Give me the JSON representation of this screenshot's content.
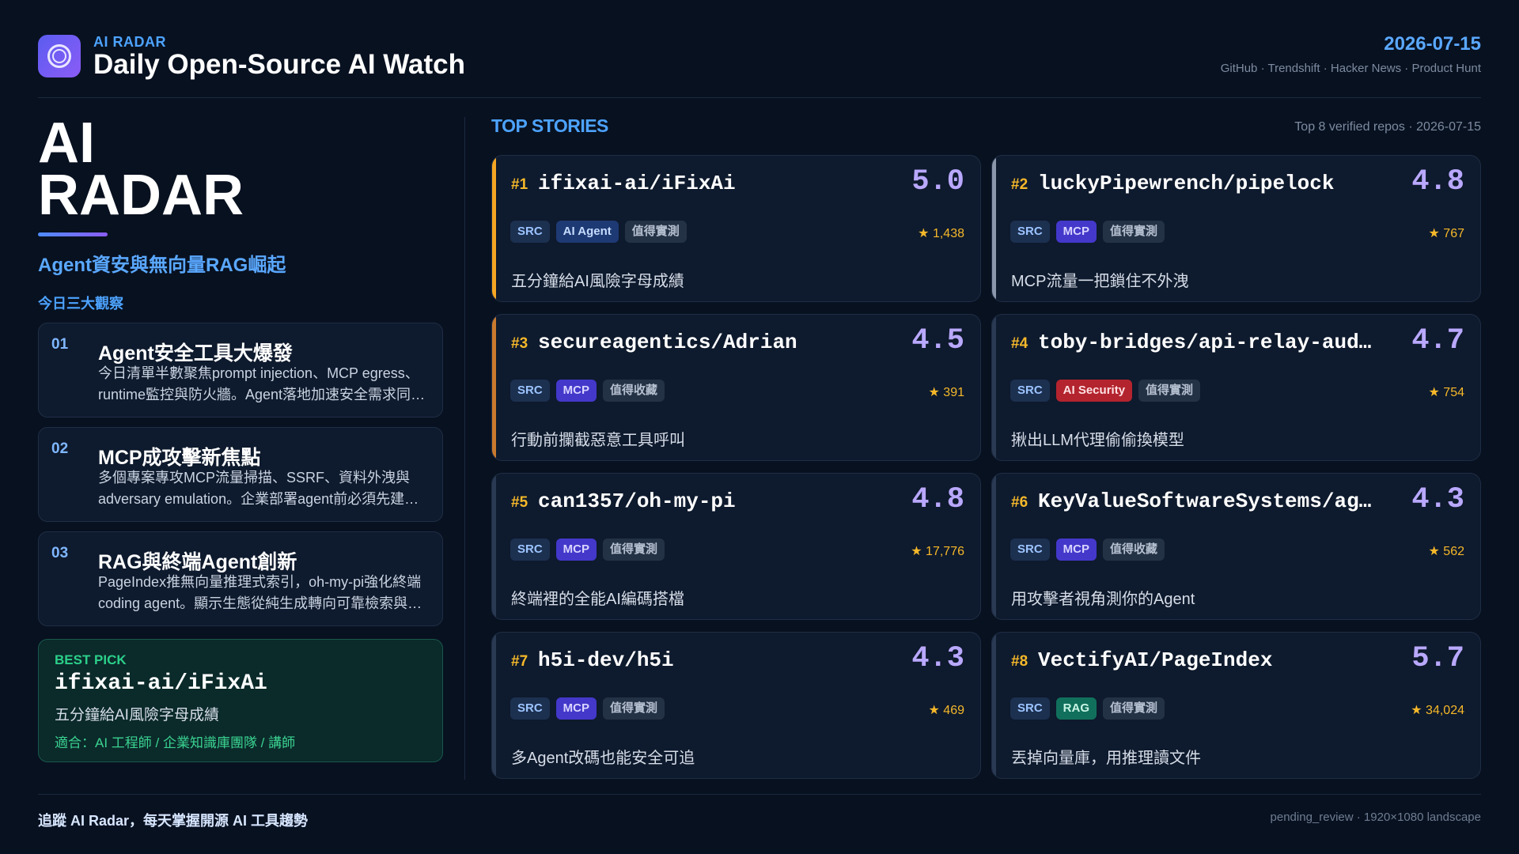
{
  "header": {
    "brand_small": "AI RADAR",
    "title": "Daily Open-Source AI Watch",
    "date": "2026-07-15",
    "sources": "GitHub · Trendshift · Hacker News · Product Hunt"
  },
  "hero": {
    "title_line1": "AI",
    "title_line2": "RADAR",
    "subtitle": "Agent資安與無向量RAG崛起"
  },
  "insights": {
    "title": "今日三大觀察",
    "items": [
      {
        "num": "01",
        "title": "Agent安全工具大爆發",
        "desc": "今日清單半數聚焦prompt injection、MCP egress、runtime監控與防火牆。Agent落地加速安全需求同步擴大。"
      },
      {
        "num": "02",
        "title": "MCP成攻擊新焦點",
        "desc": "多個專案專攻MCP流量掃描、SSRF、資料外洩與adversary emulation。企業部署agent前必須先建立防線。"
      },
      {
        "num": "03",
        "title": "RAG與終端Agent創新",
        "desc": "PageIndex推無向量推理式索引，oh-my-pi強化終端coding agent。顯示生態從純生成轉向可靠檢索與實作。"
      }
    ]
  },
  "best_pick": {
    "label": "BEST PICK",
    "repo": "ifixai-ai/iFixAi",
    "desc": "五分鐘給AI風險字母成績",
    "fit": "適合：AI 工程師 / 企業知識庫團隊 / 講師"
  },
  "stories": {
    "title": "TOP STORIES",
    "meta": "Top 8 verified repos · 2026-07-15",
    "items": [
      {
        "rank": "#1",
        "repo": "ifixai-ai/iFixAi",
        "score": "5.0",
        "tags": [
          "SRC",
          "AI Agent",
          "值得實測"
        ],
        "stars": "★ 1,438",
        "desc": "五分鐘給AI風險字母成績",
        "accent": "#f5a623"
      },
      {
        "rank": "#2",
        "repo": "luckyPipewrench/pipelock",
        "score": "4.8",
        "tags": [
          "SRC",
          "MCP",
          "值得實測"
        ],
        "stars": "★ 767",
        "desc": "MCP流量一把鎖住不外洩",
        "accent": "#8b97ab"
      },
      {
        "rank": "#3",
        "repo": "secureagentics/Adrian",
        "score": "4.5",
        "tags": [
          "SRC",
          "MCP",
          "值得收藏"
        ],
        "stars": "★ 391",
        "desc": "行動前攔截惡意工具呼叫",
        "accent": "#c97a2e"
      },
      {
        "rank": "#4",
        "repo": "toby-bridges/api-relay-audit",
        "score": "4.7",
        "tags": [
          "SRC",
          "AI Security",
          "值得實測"
        ],
        "stars": "★ 754",
        "desc": "揪出LLM代理偷偷換模型",
        "accent": "#2a3a52"
      },
      {
        "rank": "#5",
        "repo": "can1357/oh-my-pi",
        "score": "4.8",
        "tags": [
          "SRC",
          "MCP",
          "值得實測"
        ],
        "stars": "★ 17,776",
        "desc": "終端裡的全能AI編碼搭檔",
        "accent": "#2a3a52"
      },
      {
        "rank": "#6",
        "repo": "KeyValueSoftwareSystems/agentic-security",
        "score": "4.3",
        "tags": [
          "SRC",
          "MCP",
          "值得收藏"
        ],
        "stars": "★ 562",
        "desc": "用攻擊者視角測你的Agent",
        "accent": "#2a3a52"
      },
      {
        "rank": "#7",
        "repo": "h5i-dev/h5i",
        "score": "4.3",
        "tags": [
          "SRC",
          "MCP",
          "值得實測"
        ],
        "stars": "★ 469",
        "desc": "多Agent改碼也能安全可追",
        "accent": "#2a3a52"
      },
      {
        "rank": "#8",
        "repo": "VectifyAI/PageIndex",
        "score": "5.7",
        "tags": [
          "SRC",
          "RAG",
          "值得實測"
        ],
        "stars": "★ 34,024",
        "desc": "丟掉向量庫，用推理讀文件",
        "accent": "#2a3a52"
      }
    ]
  },
  "footer": {
    "left": "追蹤 AI Radar，每天掌握開源 AI 工具趨勢",
    "right": "pending_review · 1920×1080 landscape"
  }
}
